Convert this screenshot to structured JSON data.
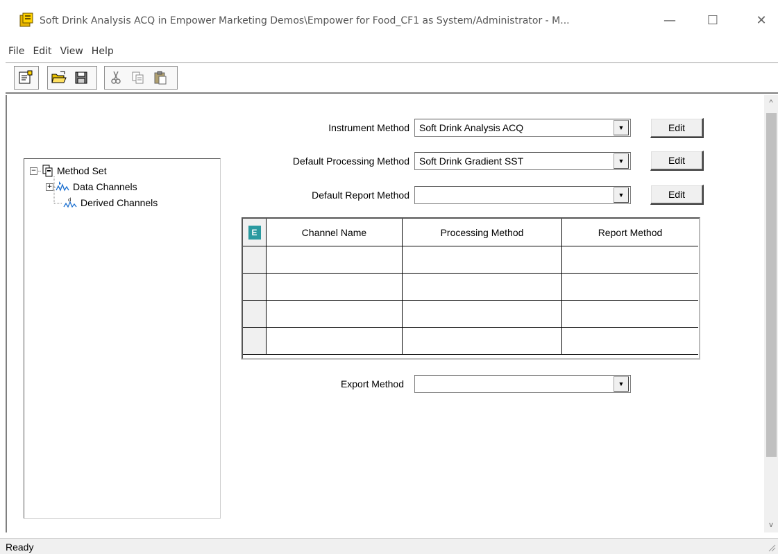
{
  "window": {
    "title": "Soft Drink Analysis ACQ in Empower Marketing Demos\\Empower for Food_CF1 as System/Administrator - M...",
    "minimize_glyph": "—",
    "maximize_glyph": "☐",
    "close_glyph": "✕"
  },
  "menu": {
    "items": [
      {
        "label": "File"
      },
      {
        "label": "Edit"
      },
      {
        "label": "View"
      },
      {
        "label": "Help"
      }
    ]
  },
  "toolbar": {
    "icons": [
      "properties-icon",
      "open-folder-icon",
      "save-icon",
      "cut-icon",
      "copy-icon",
      "paste-icon"
    ]
  },
  "tree": {
    "root": {
      "label": "Method Set",
      "expander": "−"
    },
    "children": [
      {
        "label": "Data Channels",
        "expander": "+"
      },
      {
        "label": "Derived Channels"
      }
    ]
  },
  "form": {
    "instrument_method": {
      "label": "Instrument Method",
      "value": "Soft Drink Analysis ACQ",
      "edit_label": "Edit"
    },
    "default_processing_method": {
      "label": "Default Processing Method",
      "value": "Soft Drink Gradient SST",
      "edit_label": "Edit"
    },
    "default_report_method": {
      "label": "Default Report Method",
      "value": "",
      "edit_label": "Edit"
    },
    "export_method": {
      "label": "Export Method",
      "value": ""
    }
  },
  "grid": {
    "corner_glyph": "E",
    "columns": [
      "Channel Name",
      "Processing Method",
      "Report Method"
    ],
    "rows": [
      [
        "",
        "",
        ""
      ],
      [
        "",
        "",
        ""
      ],
      [
        "",
        "",
        ""
      ],
      [
        "",
        "",
        ""
      ]
    ]
  },
  "status": {
    "text": "Ready"
  },
  "colors": {
    "accent_icon": "#d9a400",
    "grid_corner": "#2a9aa0"
  }
}
